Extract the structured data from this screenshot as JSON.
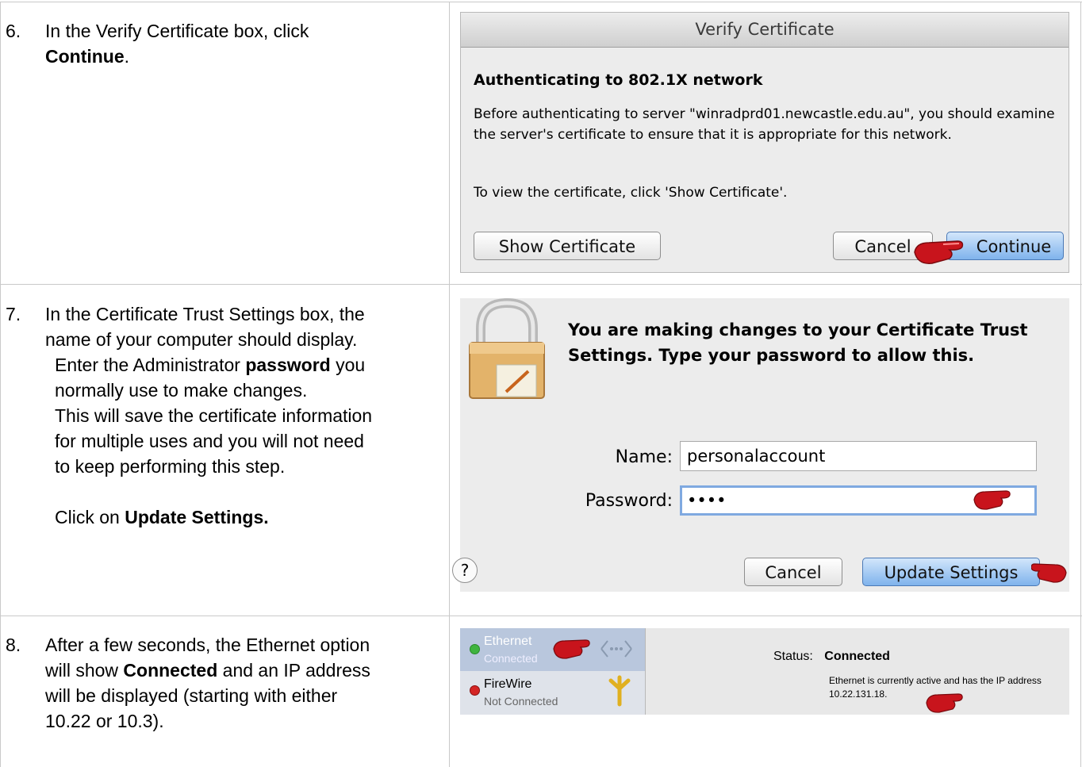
{
  "steps": [
    {
      "num": "6.",
      "line1": "In the Verify Certificate box, click",
      "bold": "Continue",
      "after": "."
    },
    {
      "num": "7.",
      "line1": "In the Certificate Trust Settings box, the",
      "line2": "name of your computer should display.",
      "line3a": "Enter the Administrator ",
      "line3b": "password",
      "line3c": " you",
      "line4": "normally use to make changes.",
      "line5": "This will save the certificate information",
      "line6": "for multiple uses and you will not need",
      "line7": "to keep performing this step.",
      "click_prefix": "Click on ",
      "click_bold": "Update Settings."
    },
    {
      "num": "8.",
      "line1": "After a few seconds, the Ethernet option",
      "line2a": "will show ",
      "line2b": "Connected",
      "line2c": " and an IP address",
      "line3": "will be displayed (starting with either",
      "line4": "10.22 or 10.3)."
    }
  ],
  "verify_dialog": {
    "title": "Verify Certificate",
    "heading": "Authenticating to 802.1X network",
    "body": "Before authenticating to server \"winradprd01.newcastle.edu.au\", you should examine the server's certificate to ensure that it is appropriate for this network.",
    "hint": "To view the certificate, click 'Show Certificate'.",
    "show_cert": "Show Certificate",
    "cancel": "Cancel",
    "continue": "Continue"
  },
  "auth_dialog": {
    "title": "You are making changes to your Certificate Trust Settings. Type your password to allow this.",
    "name_label": "Name:",
    "name_value": "personalaccount",
    "password_label": "Password:",
    "password_value": "••••",
    "help": "?",
    "cancel": "Cancel",
    "update": "Update Settings"
  },
  "network": {
    "ethernet_name": "Ethernet",
    "ethernet_status": "Connected",
    "firewire_name": "FireWire",
    "firewire_status": "Not Connected",
    "status_label": "Status:",
    "status_value": "Connected",
    "description": "Ethernet is currently active and has the IP address 10.22.131.18.",
    "colors": {
      "connected": "#3fb43f",
      "disconnected": "#d42525"
    }
  }
}
